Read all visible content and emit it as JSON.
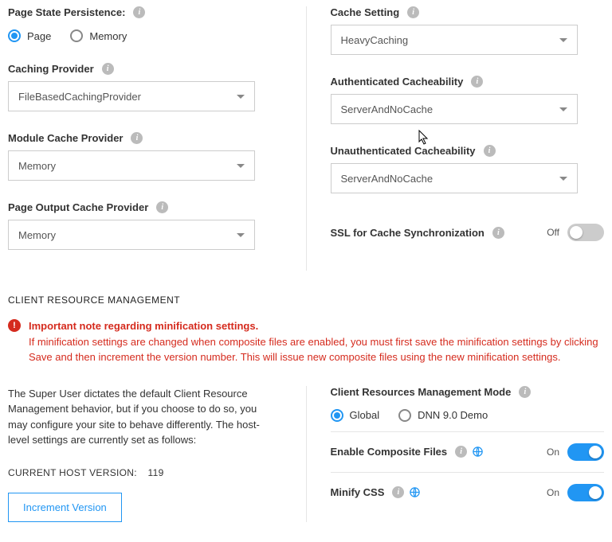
{
  "left": {
    "page_state_persistence": {
      "label": "Page State Persistence:",
      "options": [
        "Page",
        "Memory"
      ],
      "selected": "Page"
    },
    "caching_provider": {
      "label": "Caching Provider",
      "value": "FileBasedCachingProvider"
    },
    "module_cache_provider": {
      "label": "Module Cache Provider",
      "value": "Memory"
    },
    "page_output_cache_provider": {
      "label": "Page Output Cache Provider",
      "value": "Memory"
    }
  },
  "right": {
    "cache_setting": {
      "label": "Cache Setting",
      "value": "HeavyCaching"
    },
    "auth_cacheability": {
      "label": "Authenticated Cacheability",
      "value": "ServerAndNoCache"
    },
    "unauth_cacheability": {
      "label": "Unauthenticated Cacheability",
      "value": "ServerAndNoCache"
    },
    "ssl_sync": {
      "label": "SSL for Cache Synchronization",
      "state": "Off",
      "on": false
    }
  },
  "crm": {
    "section_title": "CLIENT RESOURCE MANAGEMENT",
    "alert_title": "Important note regarding minification settings.",
    "alert_body": "If minification settings are changed when composite files are enabled, you must first save the minification settings by clicking Save and then increment the version number. This will issue new composite files using the new minification settings.",
    "description": "The Super User dictates the default Client Resource Management behavior, but if you choose to do so, you may configure your site to behave differently. The host-level settings are currently set as follows:",
    "host_version_label": "CURRENT HOST VERSION:",
    "host_version_value": "119",
    "increment_button": "Increment Version",
    "mode": {
      "label": "Client Resources Management Mode",
      "options": [
        "Global",
        "DNN 9.0 Demo"
      ],
      "selected": "Global"
    },
    "composite": {
      "label": "Enable Composite Files",
      "state": "On",
      "on": true
    },
    "minify_css": {
      "label": "Minify CSS",
      "state": "On",
      "on": true
    }
  }
}
